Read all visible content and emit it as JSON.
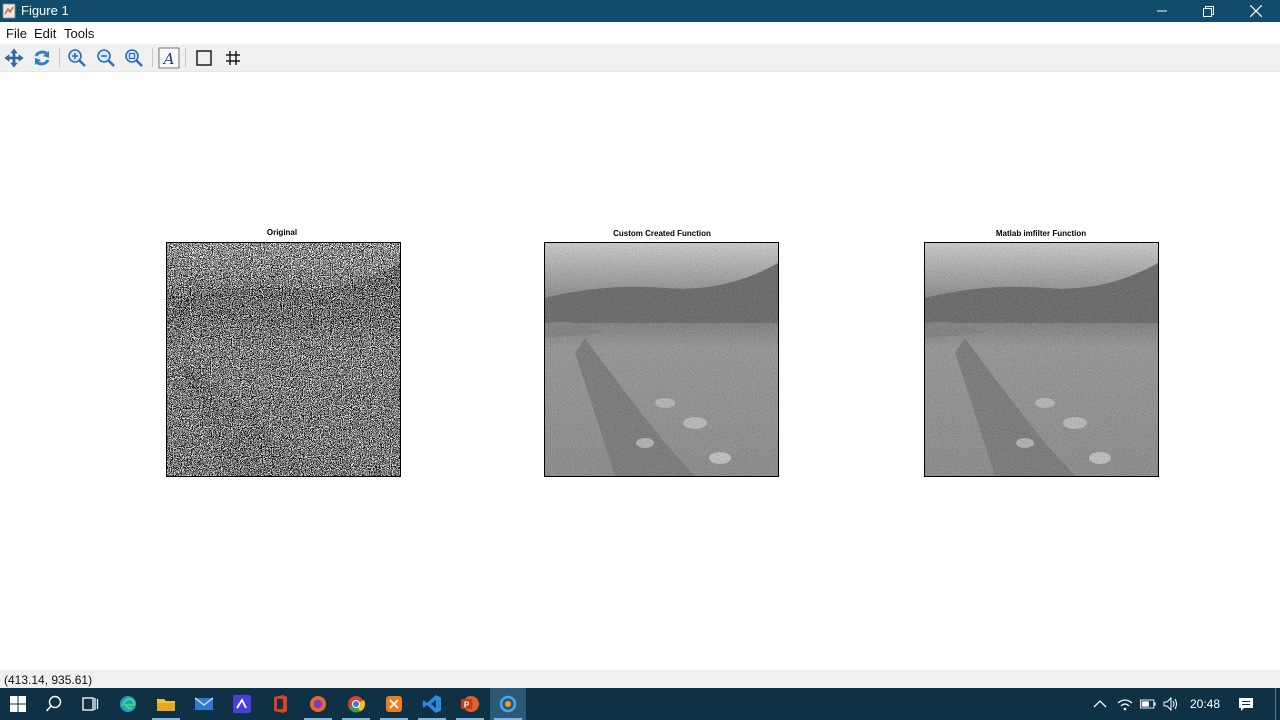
{
  "window": {
    "title": "Figure 1",
    "controls": [
      "minimize",
      "restore",
      "close"
    ]
  },
  "menu": {
    "items": [
      "File",
      "Edit",
      "Tools"
    ]
  },
  "toolbar": {
    "buttons": [
      "pan-icon",
      "rotate-icon",
      "zoom-in-icon",
      "zoom-out-icon",
      "zoom-reset-icon",
      "insert-text-icon",
      "box-icon",
      "grid-icon"
    ]
  },
  "figure": {
    "subplots": [
      {
        "title": "Original"
      },
      {
        "title": "Custom Created Function"
      },
      {
        "title": "Matlab imfilter Function"
      }
    ]
  },
  "statusbar": {
    "coordinates": "(413.14, 935.61)"
  },
  "taskbar": {
    "apps": [
      "start",
      "search",
      "task-view",
      "edge",
      "file-explorer",
      "mail",
      "vs-studio",
      "office",
      "firefox",
      "chrome",
      "app-orange",
      "vscode",
      "powerpoint",
      "octave"
    ],
    "clock": "20:48"
  },
  "colors": {
    "titlebar": "#114c6c",
    "taskbar": "#0f3146",
    "toolbar": "#f0f0f0"
  }
}
